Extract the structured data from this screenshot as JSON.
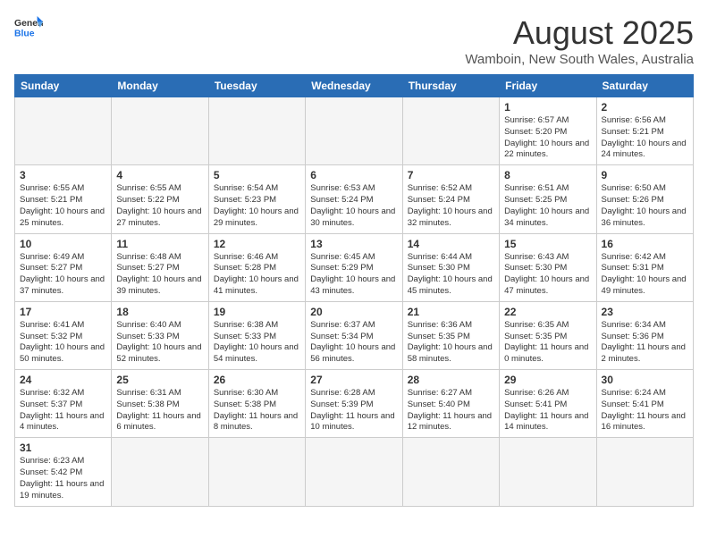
{
  "header": {
    "logo_general": "General",
    "logo_blue": "Blue",
    "title": "August 2025",
    "subtitle": "Wamboin, New South Wales, Australia"
  },
  "weekdays": [
    "Sunday",
    "Monday",
    "Tuesday",
    "Wednesday",
    "Thursday",
    "Friday",
    "Saturday"
  ],
  "weeks": [
    [
      {
        "day": "",
        "info": ""
      },
      {
        "day": "",
        "info": ""
      },
      {
        "day": "",
        "info": ""
      },
      {
        "day": "",
        "info": ""
      },
      {
        "day": "",
        "info": ""
      },
      {
        "day": "1",
        "info": "Sunrise: 6:57 AM\nSunset: 5:20 PM\nDaylight: 10 hours and 22 minutes."
      },
      {
        "day": "2",
        "info": "Sunrise: 6:56 AM\nSunset: 5:21 PM\nDaylight: 10 hours and 24 minutes."
      }
    ],
    [
      {
        "day": "3",
        "info": "Sunrise: 6:55 AM\nSunset: 5:21 PM\nDaylight: 10 hours and 25 minutes."
      },
      {
        "day": "4",
        "info": "Sunrise: 6:55 AM\nSunset: 5:22 PM\nDaylight: 10 hours and 27 minutes."
      },
      {
        "day": "5",
        "info": "Sunrise: 6:54 AM\nSunset: 5:23 PM\nDaylight: 10 hours and 29 minutes."
      },
      {
        "day": "6",
        "info": "Sunrise: 6:53 AM\nSunset: 5:24 PM\nDaylight: 10 hours and 30 minutes."
      },
      {
        "day": "7",
        "info": "Sunrise: 6:52 AM\nSunset: 5:24 PM\nDaylight: 10 hours and 32 minutes."
      },
      {
        "day": "8",
        "info": "Sunrise: 6:51 AM\nSunset: 5:25 PM\nDaylight: 10 hours and 34 minutes."
      },
      {
        "day": "9",
        "info": "Sunrise: 6:50 AM\nSunset: 5:26 PM\nDaylight: 10 hours and 36 minutes."
      }
    ],
    [
      {
        "day": "10",
        "info": "Sunrise: 6:49 AM\nSunset: 5:27 PM\nDaylight: 10 hours and 37 minutes."
      },
      {
        "day": "11",
        "info": "Sunrise: 6:48 AM\nSunset: 5:27 PM\nDaylight: 10 hours and 39 minutes."
      },
      {
        "day": "12",
        "info": "Sunrise: 6:46 AM\nSunset: 5:28 PM\nDaylight: 10 hours and 41 minutes."
      },
      {
        "day": "13",
        "info": "Sunrise: 6:45 AM\nSunset: 5:29 PM\nDaylight: 10 hours and 43 minutes."
      },
      {
        "day": "14",
        "info": "Sunrise: 6:44 AM\nSunset: 5:30 PM\nDaylight: 10 hours and 45 minutes."
      },
      {
        "day": "15",
        "info": "Sunrise: 6:43 AM\nSunset: 5:30 PM\nDaylight: 10 hours and 47 minutes."
      },
      {
        "day": "16",
        "info": "Sunrise: 6:42 AM\nSunset: 5:31 PM\nDaylight: 10 hours and 49 minutes."
      }
    ],
    [
      {
        "day": "17",
        "info": "Sunrise: 6:41 AM\nSunset: 5:32 PM\nDaylight: 10 hours and 50 minutes."
      },
      {
        "day": "18",
        "info": "Sunrise: 6:40 AM\nSunset: 5:33 PM\nDaylight: 10 hours and 52 minutes."
      },
      {
        "day": "19",
        "info": "Sunrise: 6:38 AM\nSunset: 5:33 PM\nDaylight: 10 hours and 54 minutes."
      },
      {
        "day": "20",
        "info": "Sunrise: 6:37 AM\nSunset: 5:34 PM\nDaylight: 10 hours and 56 minutes."
      },
      {
        "day": "21",
        "info": "Sunrise: 6:36 AM\nSunset: 5:35 PM\nDaylight: 10 hours and 58 minutes."
      },
      {
        "day": "22",
        "info": "Sunrise: 6:35 AM\nSunset: 5:35 PM\nDaylight: 11 hours and 0 minutes."
      },
      {
        "day": "23",
        "info": "Sunrise: 6:34 AM\nSunset: 5:36 PM\nDaylight: 11 hours and 2 minutes."
      }
    ],
    [
      {
        "day": "24",
        "info": "Sunrise: 6:32 AM\nSunset: 5:37 PM\nDaylight: 11 hours and 4 minutes."
      },
      {
        "day": "25",
        "info": "Sunrise: 6:31 AM\nSunset: 5:38 PM\nDaylight: 11 hours and 6 minutes."
      },
      {
        "day": "26",
        "info": "Sunrise: 6:30 AM\nSunset: 5:38 PM\nDaylight: 11 hours and 8 minutes."
      },
      {
        "day": "27",
        "info": "Sunrise: 6:28 AM\nSunset: 5:39 PM\nDaylight: 11 hours and 10 minutes."
      },
      {
        "day": "28",
        "info": "Sunrise: 6:27 AM\nSunset: 5:40 PM\nDaylight: 11 hours and 12 minutes."
      },
      {
        "day": "29",
        "info": "Sunrise: 6:26 AM\nSunset: 5:41 PM\nDaylight: 11 hours and 14 minutes."
      },
      {
        "day": "30",
        "info": "Sunrise: 6:24 AM\nSunset: 5:41 PM\nDaylight: 11 hours and 16 minutes."
      }
    ],
    [
      {
        "day": "31",
        "info": "Sunrise: 6:23 AM\nSunset: 5:42 PM\nDaylight: 11 hours and 19 minutes."
      },
      {
        "day": "",
        "info": ""
      },
      {
        "day": "",
        "info": ""
      },
      {
        "day": "",
        "info": ""
      },
      {
        "day": "",
        "info": ""
      },
      {
        "day": "",
        "info": ""
      },
      {
        "day": "",
        "info": ""
      }
    ]
  ]
}
